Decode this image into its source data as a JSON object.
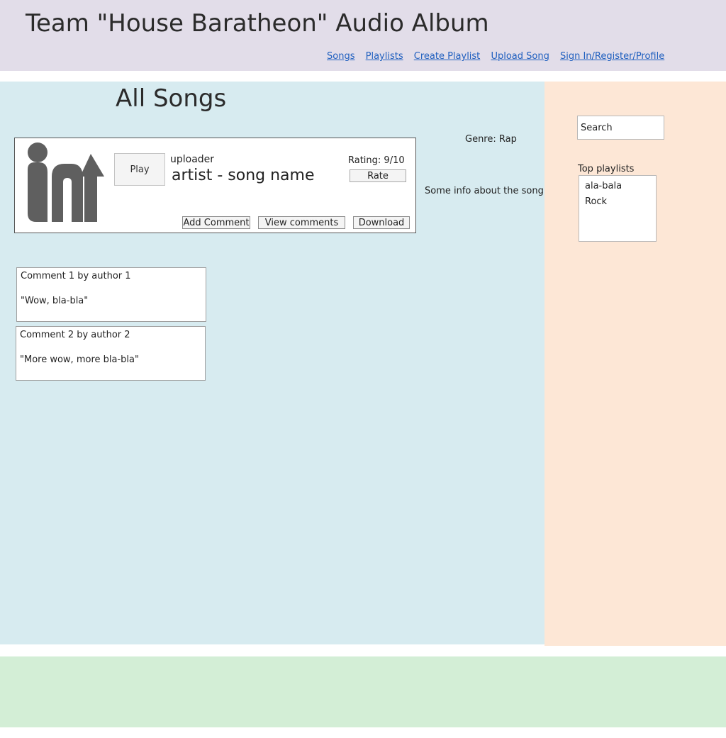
{
  "header": {
    "title": "Team \"House Baratheon\" Audio Album",
    "nav": [
      {
        "label": "Songs"
      },
      {
        "label": "Playlists"
      },
      {
        "label": "Create Playlist"
      },
      {
        "label": "Upload Song"
      },
      {
        "label": "Sign In/Register/Profile"
      }
    ]
  },
  "main": {
    "title": "All Songs",
    "song": {
      "play_label": "Play",
      "uploader": "uploader",
      "name": "artist - song name",
      "rating": "Rating: 9/10",
      "rate_label": "Rate",
      "add_comment_label": "Add Comment",
      "view_comments_label": "View comments",
      "download_label": "Download",
      "genre": "Genre: Rap",
      "info": "Some info about the song",
      "logo_icon": "in-logo-icon"
    },
    "comments": [
      {
        "header": "Comment 1 by author 1",
        "text": "\"Wow, bla-bla\""
      },
      {
        "header": "Comment 2 by author 2",
        "text": "\"More wow, more bla-bla\""
      }
    ]
  },
  "sidebar": {
    "search_placeholder": "Search",
    "top_playlists_label": "Top playlists",
    "playlists": [
      "ala-bala",
      "Rock"
    ]
  },
  "colors": {
    "header_bg": "#e2dde9",
    "main_bg": "#d7ebf0",
    "sidebar_bg": "#fde7d6",
    "footer_bg": "#d3eed6",
    "link": "#1f5fbf"
  }
}
